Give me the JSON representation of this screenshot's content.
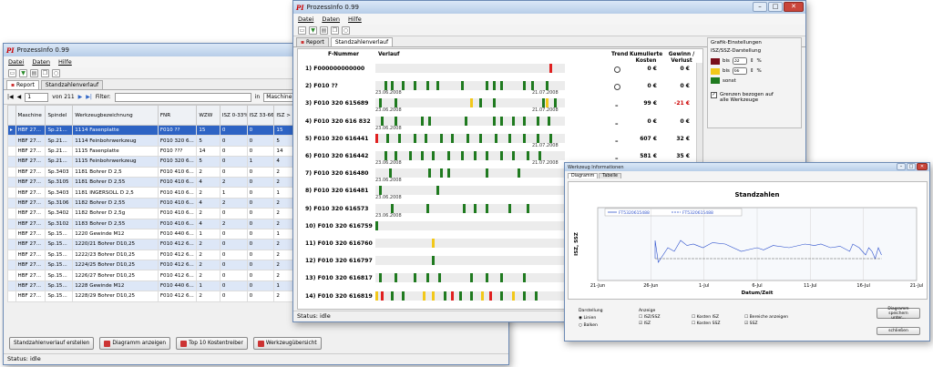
{
  "left": {
    "title": "ProzessInfo 0.99",
    "menu": [
      "Datei",
      "Daten",
      "Hilfe"
    ],
    "tabs": [
      "Report",
      "Standzahlenverlauf"
    ],
    "nav": {
      "record": "1",
      "of": "von 211",
      "filter_label": "Filter:",
      "in_label": "in",
      "in_value": "Maschine"
    },
    "columns": [
      "Maschine",
      "Spindel",
      "Werkzeugbezeichnung",
      "FNR",
      "WZW",
      "ISZ 0-33%",
      "ISZ 33-66%",
      "ISZ > 66%"
    ],
    "rows": [
      [
        "HBF 27...",
        "Sp.21...",
        "1114 Fasenplatte",
        "F010 ??",
        "15",
        "0",
        "0",
        "15"
      ],
      [
        "HBF 27...",
        "Sp.21...",
        "1114 Feinbohrwerkzeug",
        "F010 320 6...",
        "5",
        "0",
        "0",
        "5"
      ],
      [
        "HBF 27...",
        "Sp.21...",
        "1115 Fasenplatte",
        "F010 ???",
        "14",
        "0",
        "0",
        "14"
      ],
      [
        "HBF 27...",
        "Sp.21...",
        "1115 Feinbohrwerkzeug",
        "F010 320 6...",
        "5",
        "0",
        "1",
        "4"
      ],
      [
        "HBF 27...",
        "Sp.3403",
        "1181 Bohrer D 2,5",
        "F010 410 6...",
        "2",
        "0",
        "0",
        "2"
      ],
      [
        "HBF 27...",
        "Sp.3105",
        "1181 Bohrer D 2,55",
        "F010 410 6...",
        "4",
        "2",
        "0",
        "2"
      ],
      [
        "HBF 27...",
        "Sp.3403",
        "1181 INGERSOLL D 2,5",
        "F010 410 6...",
        "2",
        "1",
        "0",
        "1"
      ],
      [
        "HBF 27...",
        "Sp.3106",
        "1182 Bohrer D 2,55",
        "F010 410 6...",
        "4",
        "2",
        "0",
        "2"
      ],
      [
        "HBF 27...",
        "Sp.3402",
        "1182 Bohrer D 2,5g",
        "F010 410 6...",
        "2",
        "0",
        "0",
        "2"
      ],
      [
        "HBF 27...",
        "Sp.3102",
        "1183 Bohrer D 2,55",
        "F010 410 6...",
        "4",
        "2",
        "0",
        "2"
      ],
      [
        "HBF 27...",
        "Sp.15...",
        "1220 Gewinde M12",
        "F010 440 6...",
        "1",
        "0",
        "0",
        "1"
      ],
      [
        "HBF 27...",
        "Sp.15...",
        "1220/21 Bohrer D10,25",
        "F010 412 6...",
        "2",
        "0",
        "0",
        "2"
      ],
      [
        "HBF 27...",
        "Sp.15...",
        "1222/23 Bohrer D10,25",
        "F010 412 6...",
        "2",
        "0",
        "0",
        "2"
      ],
      [
        "HBF 27...",
        "Sp.15...",
        "1224/25 Bohrer D10,25",
        "F010 412 6...",
        "2",
        "0",
        "0",
        "2"
      ],
      [
        "HBF 27...",
        "Sp.15...",
        "1226/27 Bohrer D10,25",
        "F010 412 6...",
        "2",
        "0",
        "0",
        "2"
      ],
      [
        "HBF 27...",
        "Sp.15...",
        "1228 Gewinde M12",
        "F010 440 6...",
        "1",
        "0",
        "0",
        "1"
      ],
      [
        "HBF 27...",
        "Sp.15...",
        "1228/29 Bohrer D10,25",
        "F010 412 6...",
        "2",
        "0",
        "0",
        "2"
      ]
    ],
    "buttons": [
      "Standzahlenverlauf erstellen",
      "Diagramm anzeigen",
      "Top 10 Kostentreiber",
      "Werkzeugübersicht"
    ],
    "status": "Status: idle"
  },
  "mid": {
    "title": "ProzessInfo 0.99",
    "menu": [
      "Datei",
      "Daten",
      "Hilfe"
    ],
    "tabs": [
      "Report",
      "Standzahlenverlauf"
    ],
    "headers": {
      "fnr": "F-Nummer",
      "verlauf": "Verlauf",
      "trend": "Trend",
      "kosten": "Kumulierte Kosten",
      "gewinn": "Gewinn / Verlust"
    },
    "colors": {
      "red": "#e02020",
      "yellow": "#f2c81a",
      "green": "#1f7a1f"
    },
    "rows": [
      {
        "fnr": "1) F000000000000",
        "start": "",
        "end": "",
        "trend": "O",
        "kosten": "0 €",
        "gewinn": "0 €",
        "gewinn_neg": false,
        "segs": [
          [
            0.92,
            "red"
          ]
        ]
      },
      {
        "fnr": "2) F010 ??",
        "start": "23.06.2008",
        "end": "21.07.2008",
        "trend": "O",
        "kosten": "0 €",
        "gewinn": "0 €",
        "gewinn_neg": false,
        "segs": [
          [
            0.05,
            "green"
          ],
          [
            0.08,
            "green"
          ],
          [
            0.14,
            "green"
          ],
          [
            0.2,
            "green"
          ],
          [
            0.27,
            "green"
          ],
          [
            0.32,
            "green"
          ],
          [
            0.45,
            "green"
          ],
          [
            0.58,
            "green"
          ],
          [
            0.62,
            "green"
          ],
          [
            0.66,
            "green"
          ],
          [
            0.78,
            "green"
          ],
          [
            0.82,
            "green"
          ],
          [
            0.9,
            "green"
          ]
        ]
      },
      {
        "fnr": "3) F010 320 615689",
        "start": "23.06.2008",
        "end": "21.07.2008",
        "trend": "–",
        "kosten": "99 €",
        "gewinn": "-21 €",
        "gewinn_neg": true,
        "segs": [
          [
            0.02,
            "green"
          ],
          [
            0.1,
            "green"
          ],
          [
            0.5,
            "yellow"
          ],
          [
            0.55,
            "green"
          ],
          [
            0.62,
            "green"
          ],
          [
            0.88,
            "green"
          ],
          [
            0.9,
            "yellow"
          ],
          [
            0.94,
            "green"
          ]
        ]
      },
      {
        "fnr": "4) F010 320 616 832",
        "start": "23.06.2008",
        "end": "",
        "trend": "–",
        "kosten": "0 €",
        "gewinn": "0 €",
        "gewinn_neg": false,
        "segs": [
          [
            0.03,
            "green"
          ],
          [
            0.1,
            "green"
          ],
          [
            0.24,
            "green"
          ],
          [
            0.28,
            "green"
          ],
          [
            0.47,
            "green"
          ],
          [
            0.62,
            "green"
          ],
          [
            0.66,
            "green"
          ],
          [
            0.72,
            "green"
          ],
          [
            0.78,
            "green"
          ],
          [
            0.85,
            "green"
          ],
          [
            0.91,
            "green"
          ]
        ]
      },
      {
        "fnr": "5) F010 320 616441",
        "start": "",
        "end": "21.07.2008",
        "trend": "–",
        "kosten": "607 €",
        "gewinn": "32 €",
        "gewinn_neg": false,
        "segs": [
          [
            0.0,
            "red"
          ],
          [
            0.06,
            "green"
          ],
          [
            0.12,
            "green"
          ],
          [
            0.2,
            "green"
          ],
          [
            0.26,
            "green"
          ],
          [
            0.34,
            "green"
          ],
          [
            0.4,
            "green"
          ],
          [
            0.48,
            "green"
          ],
          [
            0.55,
            "green"
          ],
          [
            0.63,
            "green"
          ],
          [
            0.7,
            "green"
          ],
          [
            0.78,
            "green"
          ],
          [
            0.85,
            "green"
          ],
          [
            0.92,
            "green"
          ]
        ]
      },
      {
        "fnr": "6) F010 320 616442",
        "start": "23.06.2008",
        "end": "21.07.2008",
        "trend": "–",
        "kosten": "581 €",
        "gewinn": "35 €",
        "gewinn_neg": false,
        "segs": [
          [
            0.05,
            "green"
          ],
          [
            0.1,
            "green"
          ],
          [
            0.18,
            "green"
          ],
          [
            0.24,
            "green"
          ],
          [
            0.3,
            "green"
          ],
          [
            0.38,
            "green"
          ],
          [
            0.45,
            "green"
          ],
          [
            0.52,
            "green"
          ],
          [
            0.58,
            "green"
          ],
          [
            0.66,
            "green"
          ],
          [
            0.72,
            "green"
          ],
          [
            0.8,
            "green"
          ],
          [
            0.86,
            "green"
          ]
        ]
      },
      {
        "fnr": "7) F010 320 616480",
        "start": "23.06.2008",
        "end": "",
        "trend": "",
        "kosten": "",
        "gewinn": "",
        "gewinn_neg": false,
        "segs": [
          [
            0.07,
            "green"
          ],
          [
            0.28,
            "green"
          ],
          [
            0.34,
            "green"
          ],
          [
            0.38,
            "green"
          ],
          [
            0.58,
            "green"
          ],
          [
            0.75,
            "green"
          ]
        ]
      },
      {
        "fnr": "8) F010 320 616481",
        "start": "23.06.2008",
        "end": "",
        "trend": "",
        "kosten": "",
        "gewinn": "",
        "gewinn_neg": false,
        "segs": [
          [
            0.02,
            "green"
          ],
          [
            0.32,
            "green"
          ]
        ]
      },
      {
        "fnr": "9) F010 320 616573",
        "start": "23.06.2008",
        "end": "",
        "trend": "",
        "kosten": "",
        "gewinn": "",
        "gewinn_neg": false,
        "segs": [
          [
            0.08,
            "green"
          ],
          [
            0.27,
            "green"
          ],
          [
            0.46,
            "green"
          ],
          [
            0.52,
            "green"
          ],
          [
            0.58,
            "green"
          ],
          [
            0.7,
            "green"
          ],
          [
            0.8,
            "green"
          ]
        ]
      },
      {
        "fnr": "10) F010 320 616759",
        "start": "",
        "end": "",
        "trend": "",
        "kosten": "",
        "gewinn": "",
        "gewinn_neg": false,
        "segs": [
          [
            0.0,
            "green"
          ]
        ]
      },
      {
        "fnr": "11) F010 320 616760",
        "start": "",
        "end": "",
        "trend": "",
        "kosten": "",
        "gewinn": "",
        "gewinn_neg": false,
        "segs": [
          [
            0.3,
            "yellow"
          ]
        ]
      },
      {
        "fnr": "12) F010 320 616797",
        "start": "",
        "end": "",
        "trend": "",
        "kosten": "",
        "gewinn": "",
        "gewinn_neg": false,
        "segs": [
          [
            0.3,
            "green"
          ]
        ]
      },
      {
        "fnr": "13) F010 320 616817",
        "start": "",
        "end": "",
        "trend": "",
        "kosten": "",
        "gewinn": "",
        "gewinn_neg": false,
        "segs": [
          [
            0.02,
            "green"
          ],
          [
            0.1,
            "green"
          ],
          [
            0.2,
            "green"
          ],
          [
            0.27,
            "green"
          ],
          [
            0.33,
            "green"
          ],
          [
            0.5,
            "green"
          ],
          [
            0.58,
            "green"
          ],
          [
            0.66,
            "green"
          ],
          [
            0.78,
            "green"
          ]
        ]
      },
      {
        "fnr": "14) F010 320 616819",
        "start": "",
        "end": "",
        "trend": "",
        "kosten": "",
        "gewinn": "",
        "gewinn_neg": false,
        "segs": [
          [
            0.0,
            "yellow"
          ],
          [
            0.03,
            "red"
          ],
          [
            0.08,
            "green"
          ],
          [
            0.14,
            "green"
          ],
          [
            0.25,
            "yellow"
          ],
          [
            0.3,
            "yellow"
          ],
          [
            0.36,
            "green"
          ],
          [
            0.4,
            "red"
          ],
          [
            0.44,
            "green"
          ],
          [
            0.5,
            "green"
          ],
          [
            0.56,
            "yellow"
          ],
          [
            0.6,
            "red"
          ],
          [
            0.66,
            "green"
          ],
          [
            0.72,
            "yellow"
          ],
          [
            0.78,
            "green"
          ],
          [
            0.84,
            "green"
          ]
        ]
      }
    ],
    "grafik": {
      "title": "Grafik-Einstellungen",
      "sub": "ISZ/SSZ-Darstellung",
      "bis1": "bis",
      "v1": "33",
      "bis2": "bis",
      "v2": "66",
      "pct": "%",
      "sonst": "sonst",
      "checkbox": "Grenzen bezogen auf alle Werkzeuge"
    },
    "status": "Status: idle"
  },
  "right": {
    "title": "Werkzeug Informationen",
    "tabs": [
      "Diagramm",
      "Tabelle"
    ],
    "chart_title": "Standzahlen",
    "legend": [
      "FT5320615488",
      "FT5320615488"
    ],
    "ylabel": "ISZ, SSZ",
    "xlabel": "Datum/Zeit",
    "bottom_groups": {
      "darstellung": "Darstellung",
      "linien": "Linien",
      "balken": "Balken",
      "anzeige": "Anzeige",
      "checks": [
        "ISZ/SSZ",
        "Kosten ISZ",
        "Bereiche anzeigen",
        "ISZ",
        "Kosten SSZ",
        "SSZ"
      ]
    },
    "btn_save": "Diagramm speichern unter...",
    "btn_close": "schließen"
  },
  "chart_data": {
    "type": "line",
    "title": "Standzahlen",
    "xlabel": "Datum/Zeit",
    "ylabel": "ISZ, SSZ",
    "x_ticks": [
      "21-Jun",
      "26-Jun",
      "1-Jul",
      "6-Jul",
      "11-Jul",
      "16-Jul",
      "21-Jul"
    ],
    "series": [
      {
        "name": "FT5320615488",
        "x": [
          0.18,
          0.18,
          0.19,
          0.22,
          0.24,
          0.26,
          0.28,
          0.3,
          0.33,
          0.36,
          0.4,
          0.45,
          0.5,
          0.52,
          0.55,
          0.6,
          0.65,
          0.68,
          0.7,
          0.73,
          0.76,
          0.79,
          0.8,
          0.82,
          0.83,
          0.84,
          0.85,
          0.86,
          0.87,
          0.88,
          0.89
        ],
        "y": [
          0.3,
          0.55,
          0.25,
          0.45,
          0.4,
          0.55,
          0.48,
          0.5,
          0.45,
          0.52,
          0.5,
          0.4,
          0.45,
          0.42,
          0.48,
          0.45,
          0.5,
          0.48,
          0.5,
          0.45,
          0.47,
          0.4,
          0.5,
          0.45,
          0.4,
          0.35,
          0.45,
          0.4,
          0.3,
          0.45,
          0.35
        ]
      },
      {
        "name": "FT5320615488",
        "x": [
          0.18,
          0.89
        ],
        "y": [
          0.3,
          0.3
        ]
      }
    ]
  }
}
